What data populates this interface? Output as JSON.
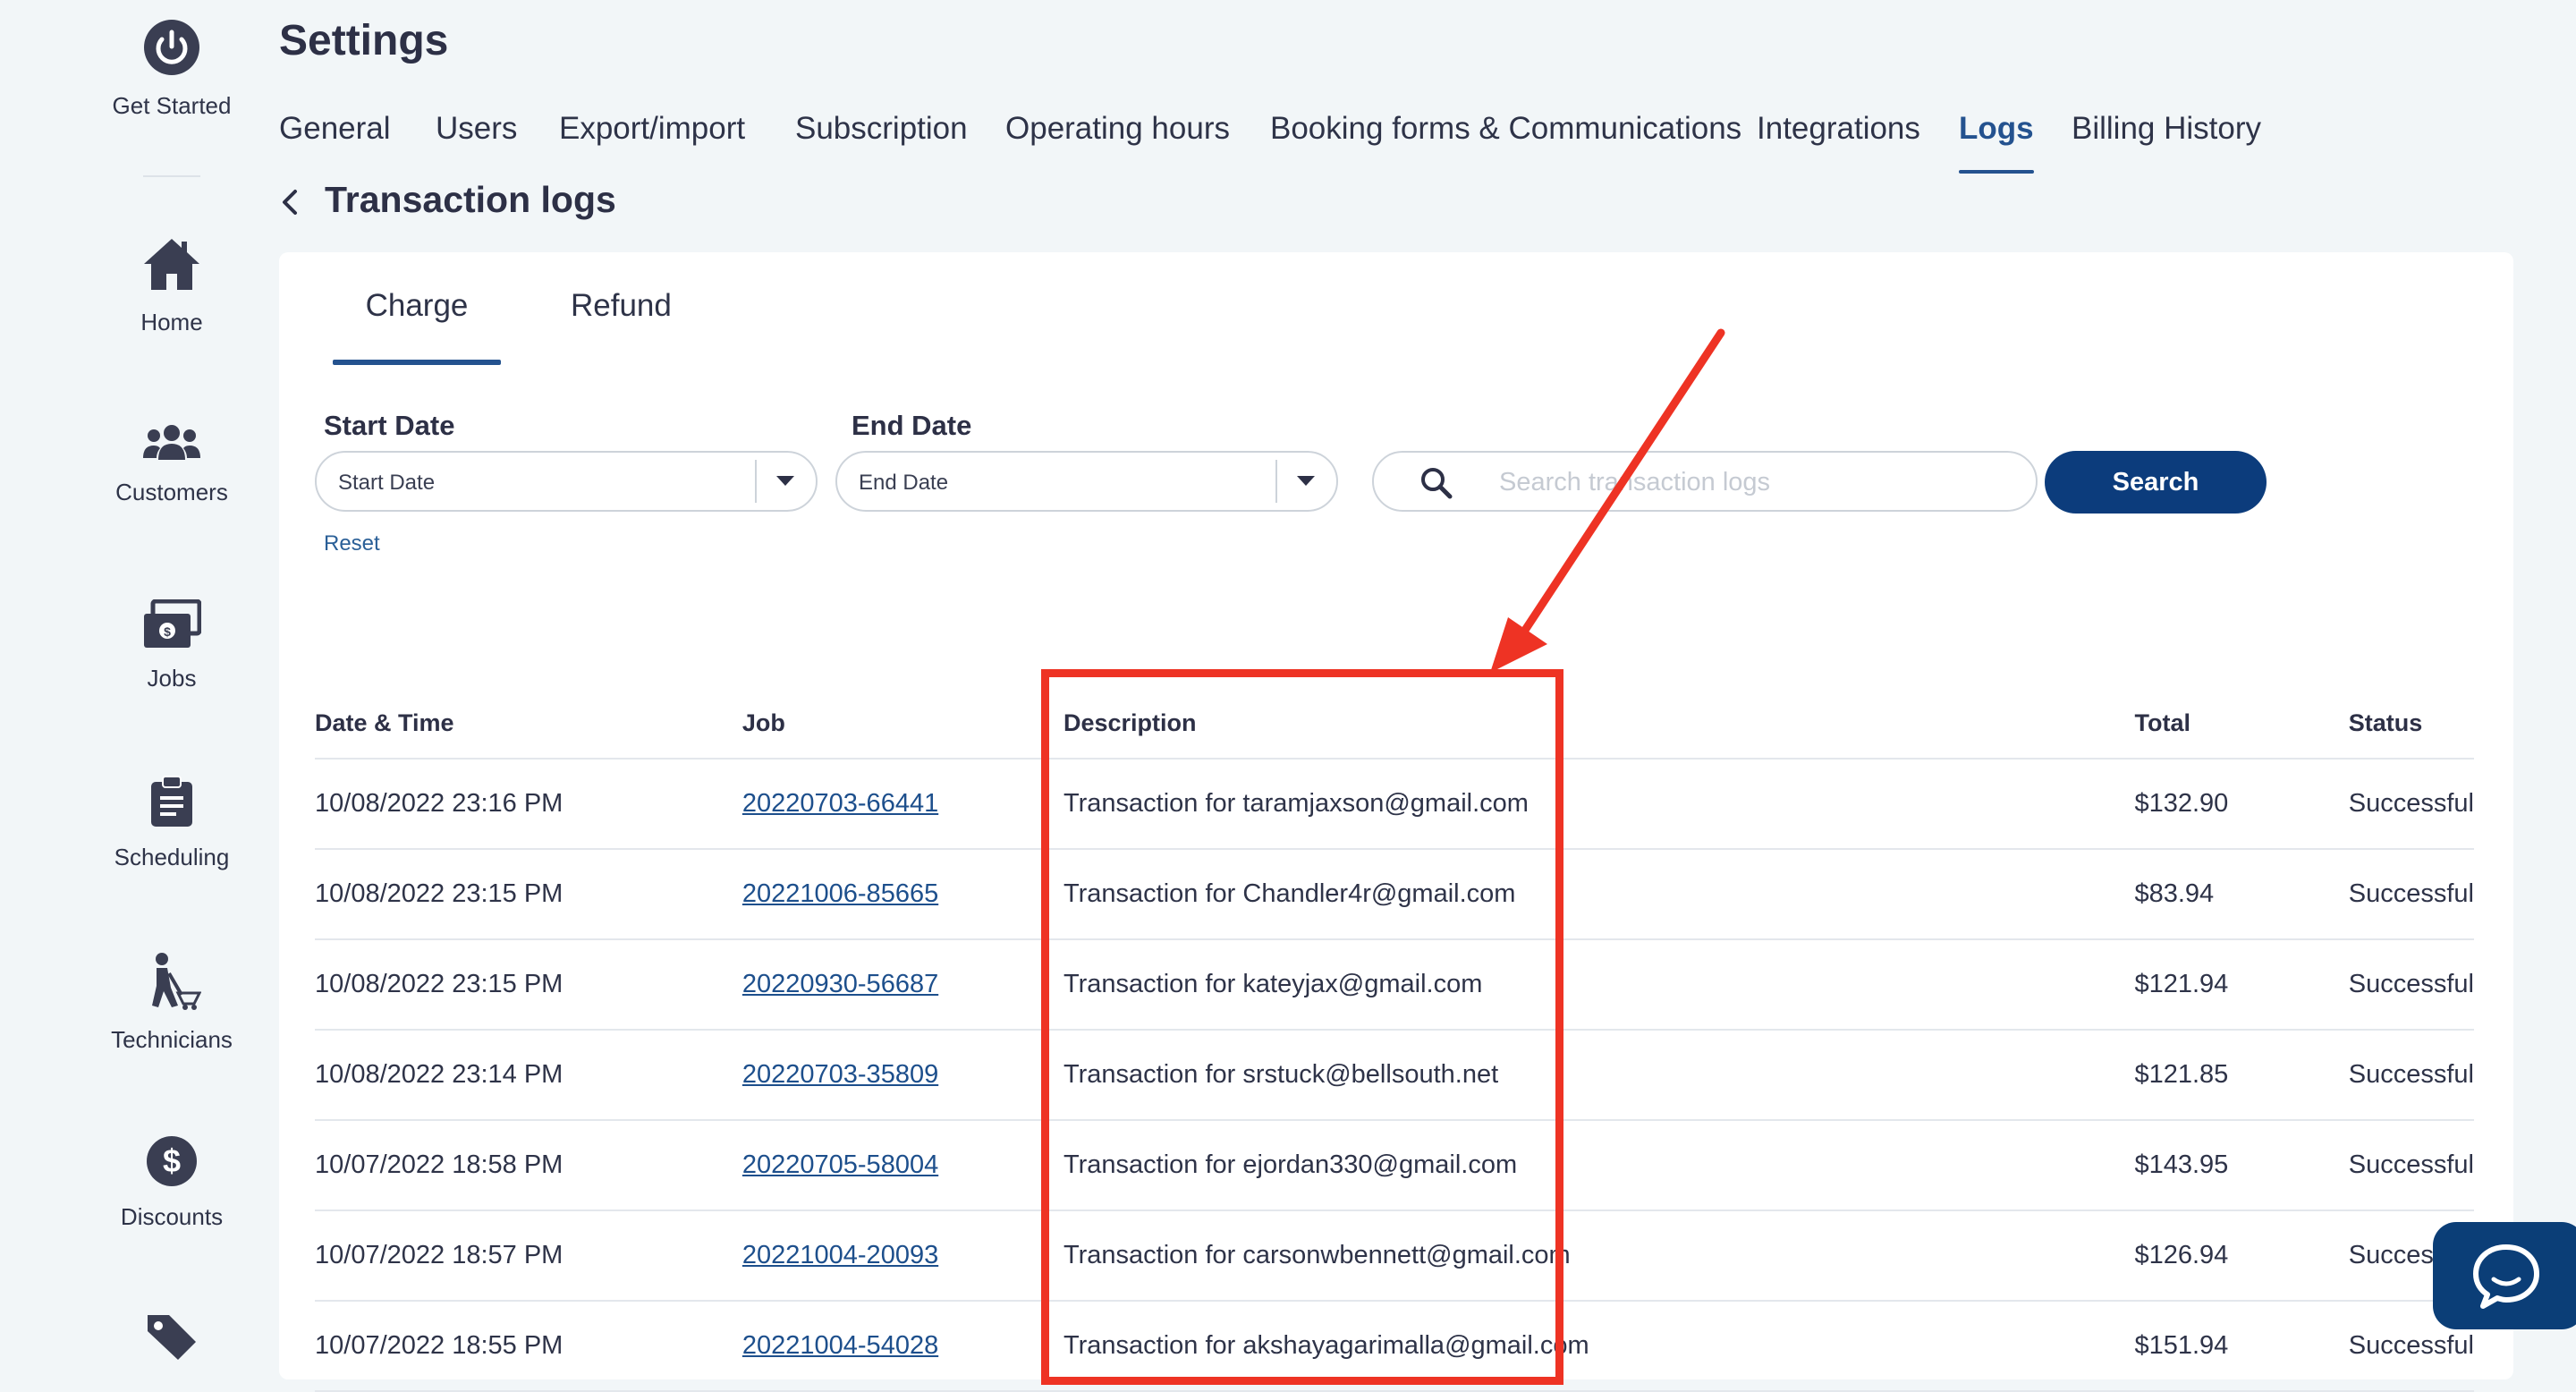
{
  "sidebar": {
    "items": [
      {
        "label": "Get Started",
        "icon": "power-icon"
      },
      {
        "label": "Home",
        "icon": "home-icon"
      },
      {
        "label": "Customers",
        "icon": "customers-icon"
      },
      {
        "label": "Jobs",
        "icon": "jobs-icon"
      },
      {
        "label": "Scheduling",
        "icon": "clipboard-icon"
      },
      {
        "label": "Technicians",
        "icon": "technician-icon"
      },
      {
        "label": "Discounts",
        "icon": "dollar-icon"
      },
      {
        "label": "",
        "icon": "tag-icon"
      }
    ]
  },
  "header": {
    "title": "Settings",
    "tabs": [
      "General",
      "Users",
      "Export/import",
      "Subscription",
      "Operating hours",
      "Booking forms & Communications",
      "Integrations",
      "Logs",
      "Billing History"
    ],
    "active_tab": "Logs"
  },
  "page": {
    "subtitle": "Transaction logs"
  },
  "subtabs": {
    "charge": "Charge",
    "refund": "Refund",
    "active": "Charge"
  },
  "filters": {
    "start_label": "Start Date",
    "start_placeholder": "Start Date",
    "end_label": "End Date",
    "end_placeholder": "End Date",
    "search_placeholder": "Search transaction logs",
    "search_button": "Search",
    "reset": "Reset"
  },
  "table": {
    "headers": [
      "Date & Time",
      "Job",
      "Description",
      "Total",
      "Status"
    ],
    "rows": [
      {
        "datetime": "10/08/2022 23:16 PM",
        "job": "20220703-66441",
        "description": "Transaction for taramjaxson@gmail.com",
        "total": "$132.90",
        "status": "Successful"
      },
      {
        "datetime": "10/08/2022 23:15 PM",
        "job": "20221006-85665",
        "description": "Transaction for Chandler4r@gmail.com",
        "total": "$83.94",
        "status": "Successful"
      },
      {
        "datetime": "10/08/2022 23:15 PM",
        "job": "20220930-56687",
        "description": "Transaction for kateyjax@gmail.com",
        "total": "$121.94",
        "status": "Successful"
      },
      {
        "datetime": "10/08/2022 23:14 PM",
        "job": "20220703-35809",
        "description": "Transaction for srstuck@bellsouth.net",
        "total": "$121.85",
        "status": "Successful"
      },
      {
        "datetime": "10/07/2022 18:58 PM",
        "job": "20220705-58004",
        "description": "Transaction for ejordan330@gmail.com",
        "total": "$143.95",
        "status": "Successful"
      },
      {
        "datetime": "10/07/2022 18:57 PM",
        "job": "20221004-20093",
        "description": "Transaction for carsonwbennett@gmail.com",
        "total": "$126.94",
        "status": "Successful"
      },
      {
        "datetime": "10/07/2022 18:55 PM",
        "job": "20221004-54028",
        "description": "Transaction for akshayagarimalla@gmail.com",
        "total": "$151.94",
        "status": "Successful"
      }
    ]
  },
  "colors": {
    "accent": "#24528f",
    "button": "#0c3c7c",
    "annotation": "#ee3324",
    "background": "#f2f6f8"
  },
  "chat": {
    "icon": "chat-bubble-icon"
  }
}
